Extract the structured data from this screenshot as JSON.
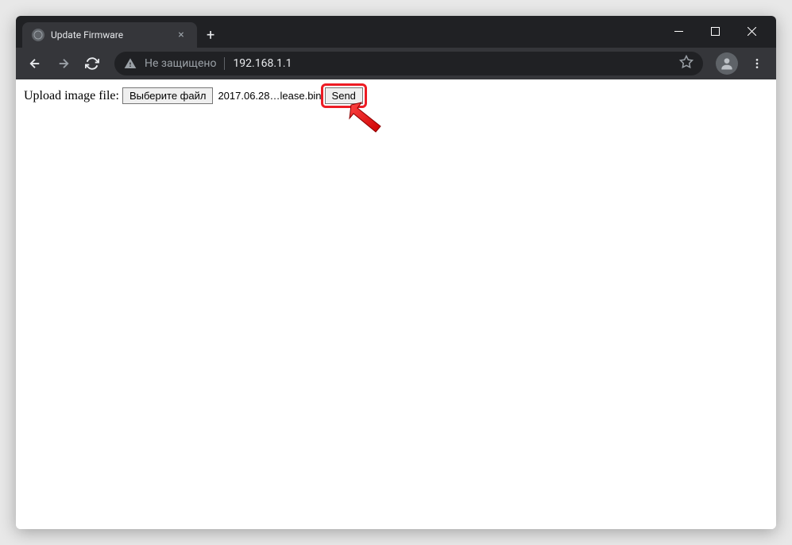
{
  "window": {
    "tab_title": "Update Firmware"
  },
  "addressbar": {
    "security_label": "Не защищено",
    "url": "192.168.1.1"
  },
  "page": {
    "upload_label": "Upload image file:",
    "file_button_label": "Выберите файл",
    "selected_file": "2017.06.28…lease.bin",
    "send_button_label": "Send"
  }
}
